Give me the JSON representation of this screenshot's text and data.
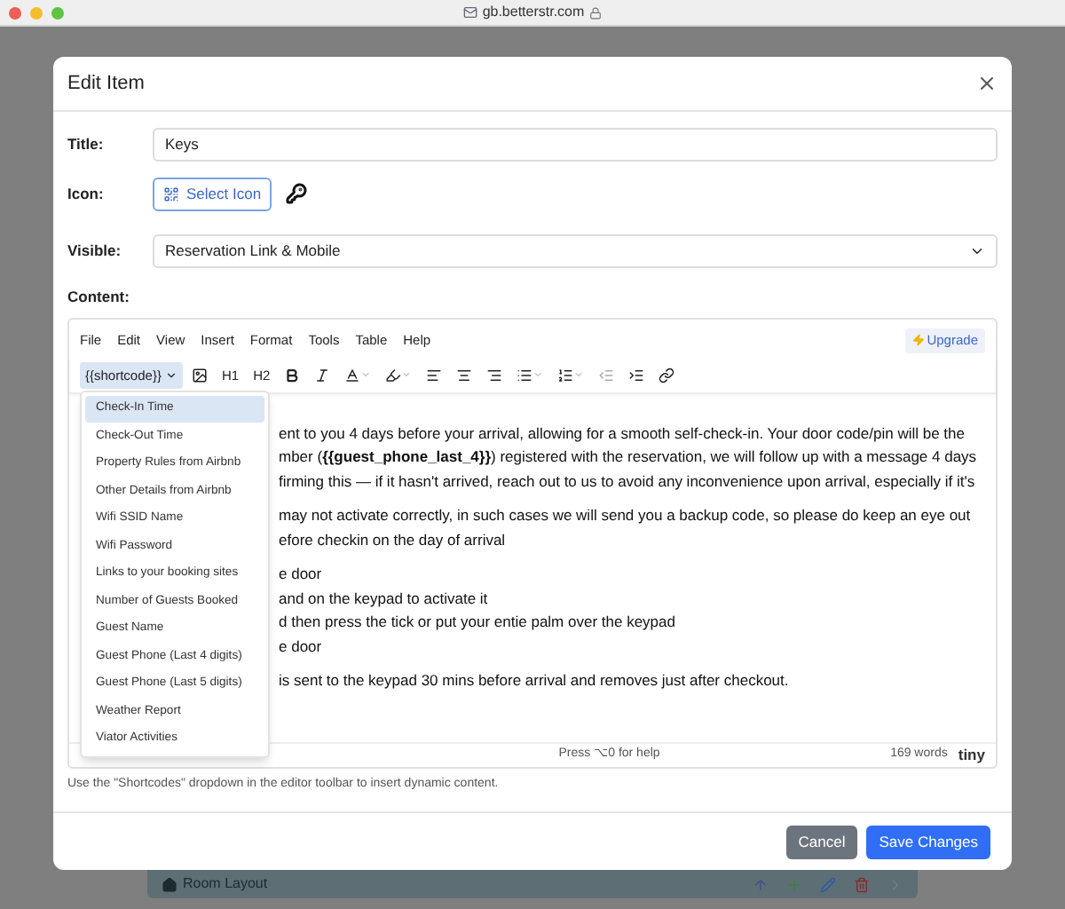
{
  "browser": {
    "url": "gb.betterstr.com"
  },
  "modal": {
    "title": "Edit Item",
    "title_field": {
      "label": "Title:",
      "value": "Keys"
    },
    "icon_field": {
      "label": "Icon:",
      "button": "Select Icon"
    },
    "visible_field": {
      "label": "Visible:",
      "value": "Reservation Link & Mobile"
    },
    "content_label": "Content:"
  },
  "editor": {
    "menus": [
      "File",
      "Edit",
      "View",
      "Insert",
      "Format",
      "Tools",
      "Table",
      "Help"
    ],
    "upgrade": "Upgrade",
    "shortcode": "{{shortcode}}",
    "headings": [
      "H1",
      "H2"
    ],
    "dropdown": [
      {
        "label": "Check-In Time",
        "selected": true
      },
      {
        "label": "Check-Out Time",
        "selected": false
      },
      {
        "label": "Property Rules from Airbnb",
        "selected": false
      },
      {
        "label": "Other Details from Airbnb",
        "selected": false
      },
      {
        "label": "Wifi SSID Name",
        "selected": false
      },
      {
        "label": "Wifi Password",
        "selected": false
      },
      {
        "label": "Links to your booking sites",
        "selected": false
      },
      {
        "label": "Number of Guests Booked",
        "selected": false
      },
      {
        "label": "Guest Name",
        "selected": false
      },
      {
        "label": "Guest Phone (Last 4 digits)",
        "selected": false
      },
      {
        "label": "Guest Phone (Last 5 digits)",
        "selected": false
      },
      {
        "label": "Weather Report",
        "selected": false
      },
      {
        "label": "Viator Activities",
        "selected": false
      }
    ],
    "paragraphs": [
      [
        "ent to you 4 days before your arrival, allowing for a smooth self-check-in. Your door code/pin will be the",
        "mber (**{{guest_phone_last_4}}**) registered with the reservation, we will follow up with a message 4 days",
        "firming this — if it hasn't arrived, reach out to us to avoid any inconvenience upon arrival, especially if it's"
      ],
      [
        "may not activate correctly, in such cases we will send you a backup code, so please do keep an eye out",
        "efore checkin on the day of arrival"
      ],
      [
        "e door",
        "and on the keypad to activate it",
        "d then press the tick or put your entie palm over the keypad",
        "e door"
      ],
      [
        "is sent to the keypad 30 mins before arrival and removes just after checkout."
      ]
    ],
    "help": "Press ⌥0 for help",
    "words": "169 words",
    "brand": "tiny"
  },
  "hint": "Use the \"Shortcodes\" dropdown in the editor toolbar to insert dynamic content.",
  "buttons": {
    "cancel": "Cancel",
    "save": "Save Changes"
  },
  "background": {
    "row_title": "Room Layout"
  }
}
